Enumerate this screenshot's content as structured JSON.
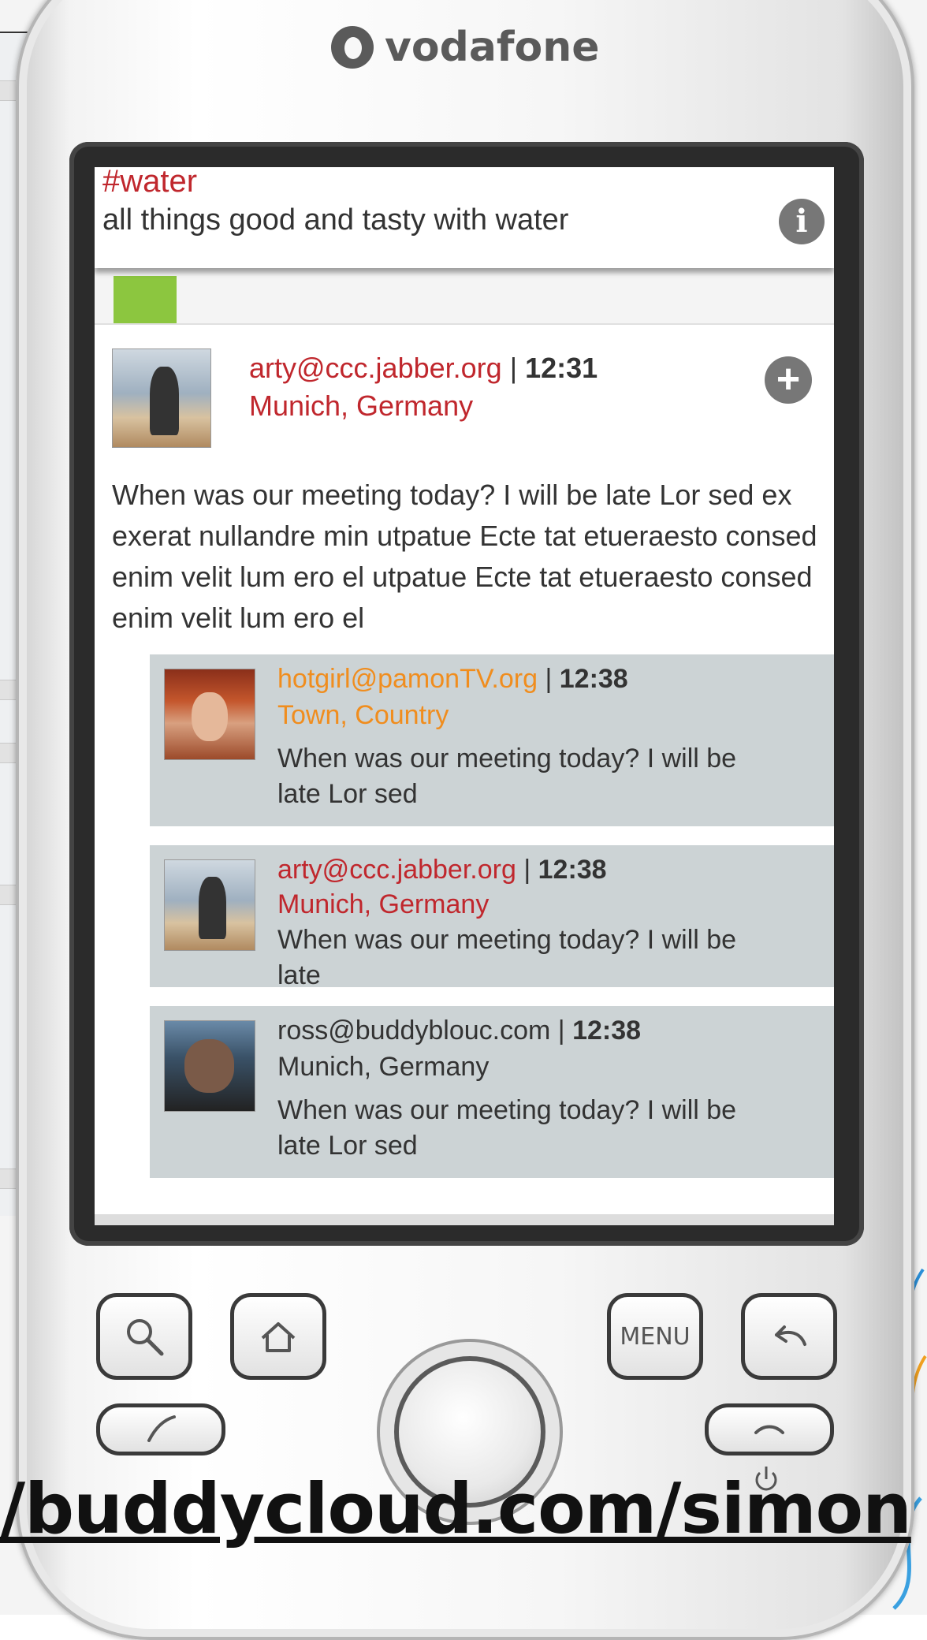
{
  "carrier": {
    "name": "vodafone"
  },
  "channel": {
    "tag": "#water",
    "description": "all things good and tasty with water"
  },
  "post": {
    "author": "arty@ccc.jabber.org",
    "time": "12:31",
    "location": "Munich, Germany",
    "body": "When was our meeting today? I will be late Lor sed ex exerat nullandre min utpatue Ecte tat etueraesto consed enim velit lum ero el utpatue Ecte tat etueraesto consed enim velit lum ero el"
  },
  "replies": [
    {
      "author": "hotgirl@pamonTV.org",
      "time": "12:38",
      "location": "Town, Country",
      "text": "When was our meeting today? I will be late Lor sed"
    },
    {
      "author": "arty@ccc.jabber.org",
      "time": "12:38",
      "location": "Munich, Germany",
      "text": "When was our meeting today? I will be late"
    },
    {
      "author": "ross@buddyblouc.com",
      "time": "12:38",
      "location": "Munich, Germany",
      "text": "When was our meeting today? I will be late Lor sed"
    }
  ],
  "separator": "|",
  "phone_buttons": {
    "menu_label": "MENU"
  },
  "footer": {
    "url": "/buddycloud.com/simon"
  },
  "icons": {
    "info": "info-icon",
    "add": "plus-circle-icon",
    "search": "search-icon",
    "home": "home-icon",
    "back": "back-arrow-icon",
    "call": "call-icon",
    "end_call": "end-call-icon",
    "power": "power-icon"
  },
  "colors": {
    "tag_red": "#c0272d",
    "reply_orange": "#f08d1e",
    "tab_green": "#8cc63f",
    "reply_bg": "#ccd3d5"
  }
}
